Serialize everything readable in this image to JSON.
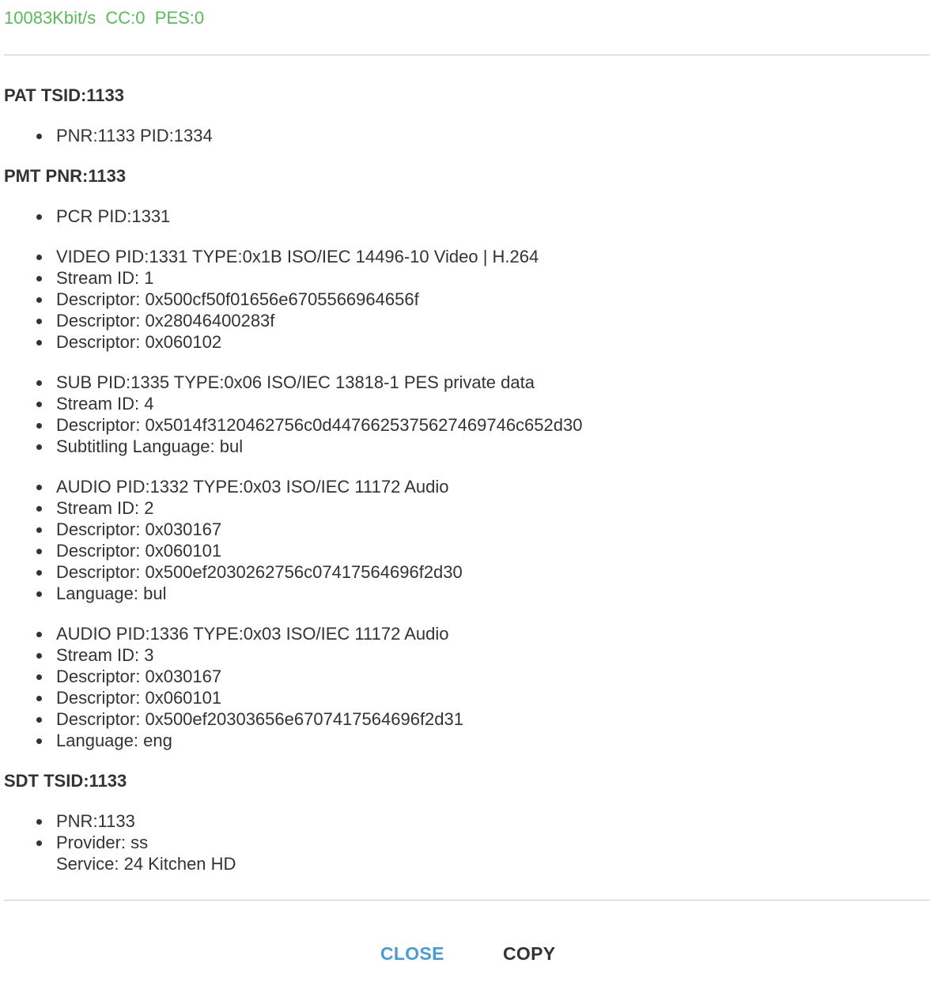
{
  "status": "10083Kbit/s  CC:0  PES:0",
  "pat": {
    "title": "PAT TSID:1133",
    "items": [
      "PNR:1133 PID:1334"
    ]
  },
  "pmt": {
    "title": "PMT PNR:1133",
    "pcr": "PCR PID:1331",
    "video": [
      "VIDEO PID:1331 TYPE:0x1B ISO/IEC 14496-10 Video | H.264",
      "Stream ID: 1",
      "Descriptor: 0x500cf50f01656e6705566964656f",
      "Descriptor: 0x28046400283f",
      "Descriptor: 0x060102"
    ],
    "sub": [
      "SUB PID:1335 TYPE:0x06 ISO/IEC 13818-1 PES private data",
      "Stream ID: 4",
      "Descriptor: 0x5014f3120462756c0d4476625375627469746c652d30",
      "Subtitling Language: bul"
    ],
    "audio1": [
      "AUDIO PID:1332 TYPE:0x03 ISO/IEC 11172 Audio",
      "Stream ID: 2",
      "Descriptor: 0x030167",
      "Descriptor: 0x060101",
      "Descriptor: 0x500ef2030262756c07417564696f2d30",
      "Language: bul"
    ],
    "audio2": [
      "AUDIO PID:1336 TYPE:0x03 ISO/IEC 11172 Audio",
      "Stream ID: 3",
      "Descriptor: 0x030167",
      "Descriptor: 0x060101",
      "Descriptor: 0x500ef20303656e6707417564696f2d31",
      "Language: eng"
    ]
  },
  "sdt": {
    "title": "SDT TSID:1133",
    "pnr": "PNR:1133",
    "provider": "Provider: ss",
    "service": "Service: 24 Kitchen HD"
  },
  "buttons": {
    "close": "CLOSE",
    "copy": "COPY"
  }
}
